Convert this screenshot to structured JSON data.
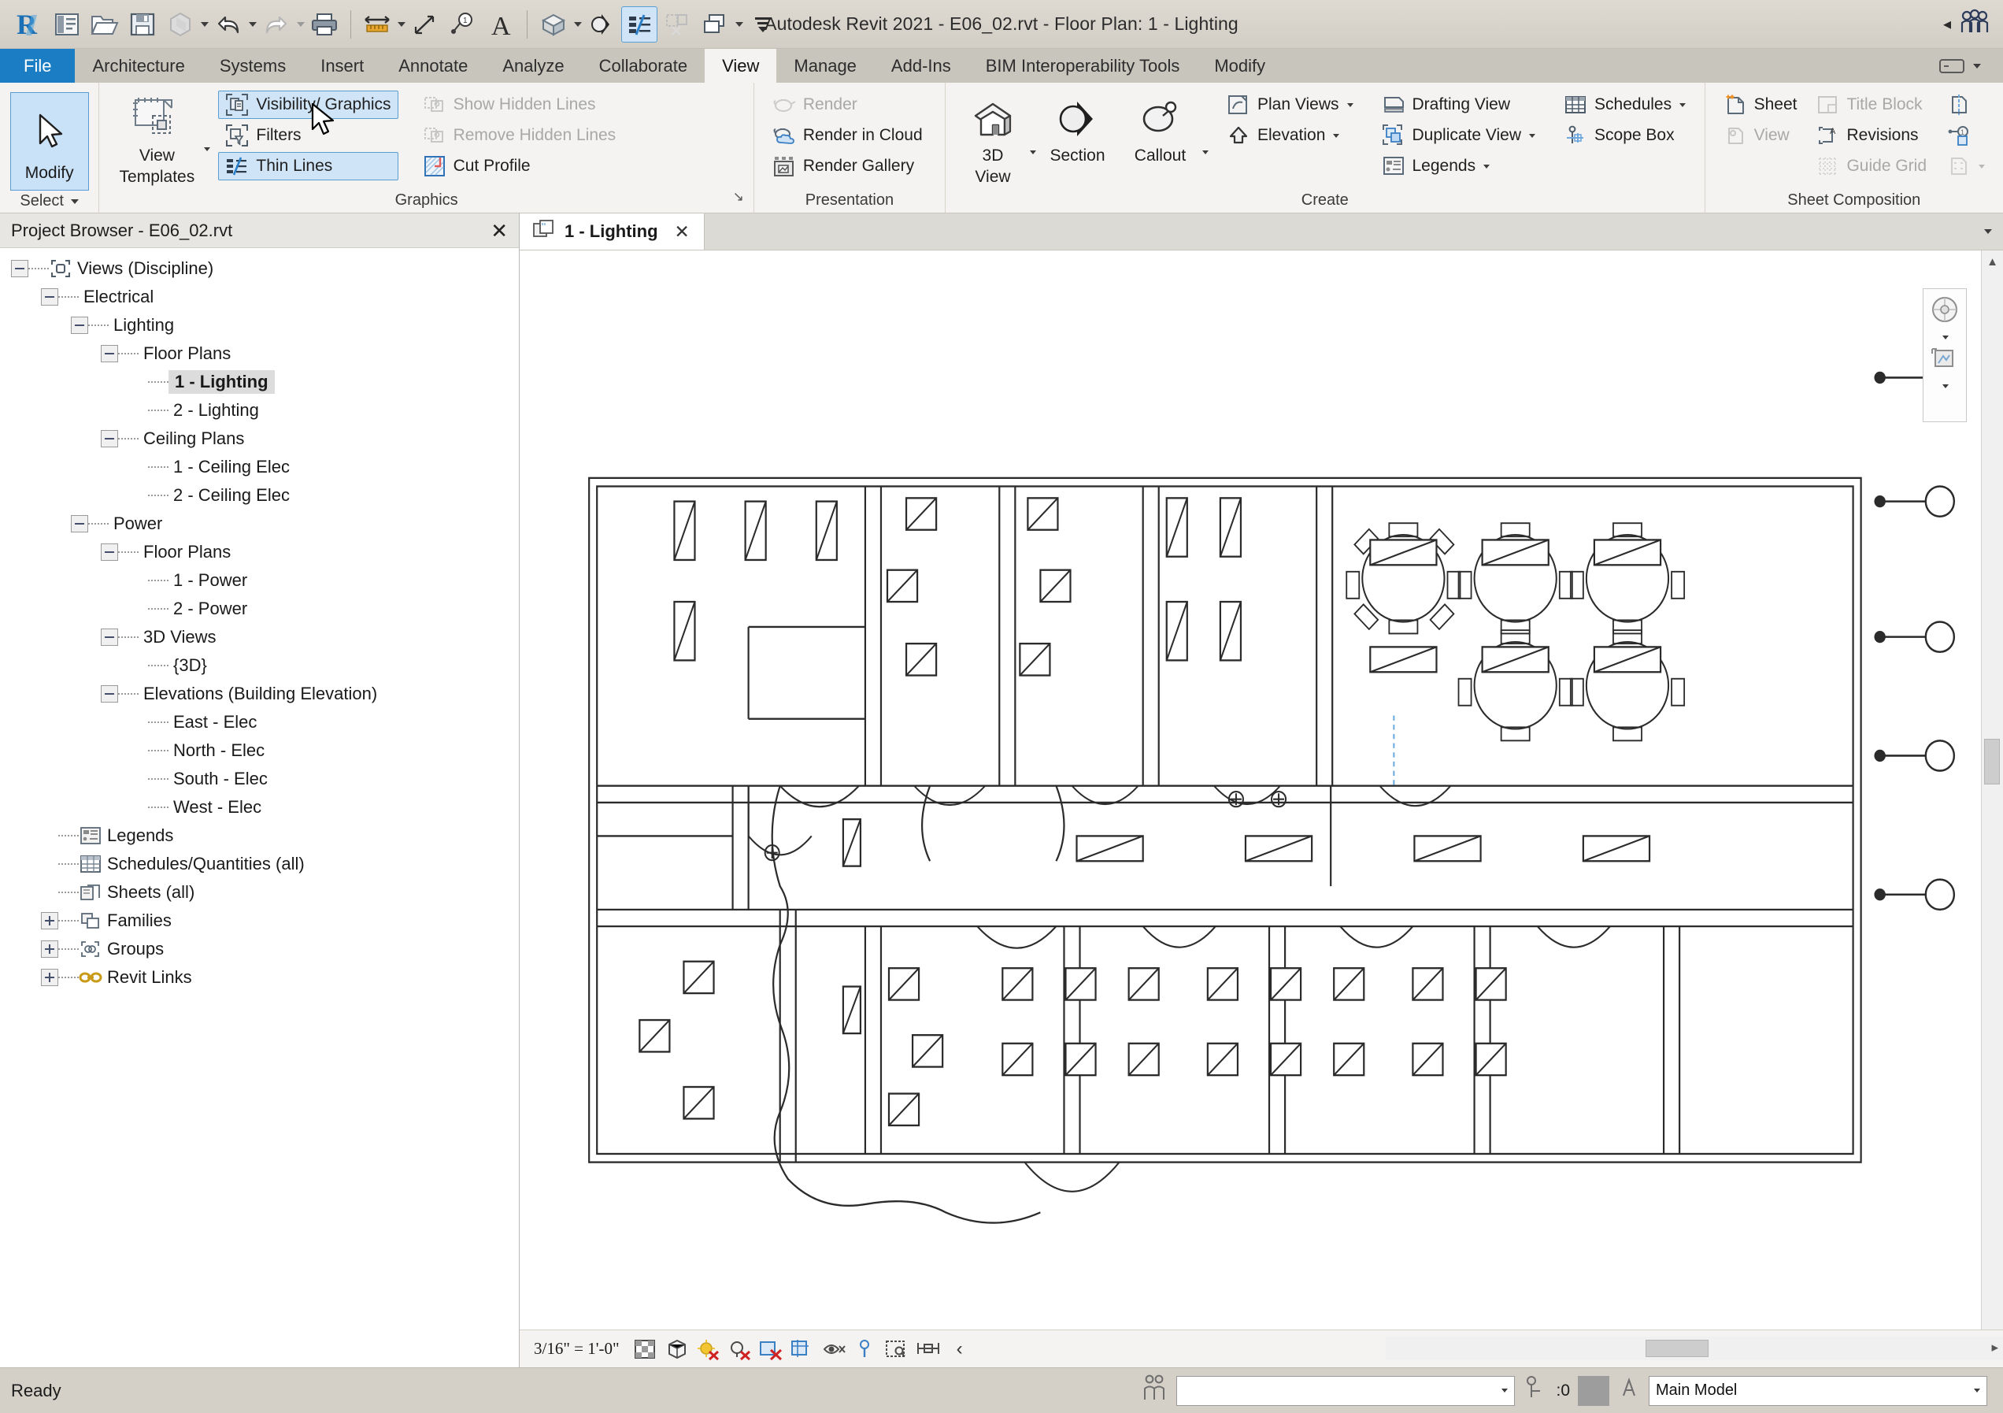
{
  "window": {
    "title": "Autodesk Revit 2021 - E06_02.rvt - Floor Plan: 1 - Lighting"
  },
  "quick_access": {
    "items": [
      {
        "name": "revit-logo-icon",
        "label": "R"
      },
      {
        "name": "project-icon",
        "label": "Project"
      },
      {
        "name": "open-icon",
        "label": "Open"
      },
      {
        "name": "save-icon",
        "label": "Save"
      },
      {
        "name": "sync-icon",
        "label": "Synchronize"
      },
      {
        "name": "undo-icon",
        "label": "Undo"
      },
      {
        "name": "redo-icon",
        "label": "Redo"
      },
      {
        "name": "print-icon",
        "label": "Print"
      },
      {
        "name": "measure-icon",
        "label": "Measure"
      },
      {
        "name": "aligned-dimension-icon",
        "label": "Aligned Dimension"
      },
      {
        "name": "tag-icon",
        "label": "Tag by Category"
      },
      {
        "name": "text-icon",
        "label": "Text"
      },
      {
        "name": "default-3d-view-icon",
        "label": "Default 3D View"
      },
      {
        "name": "section-icon",
        "label": "Section"
      },
      {
        "name": "thin-lines-icon",
        "label": "Thin Lines"
      },
      {
        "name": "close-hidden-windows-icon",
        "label": "Close Hidden Windows"
      },
      {
        "name": "switch-windows-icon",
        "label": "Switch Windows"
      },
      {
        "name": "customize-qat-icon",
        "label": "Customize Quick Access Toolbar"
      }
    ]
  },
  "tabs": {
    "items": [
      {
        "label": "File",
        "state": "file"
      },
      {
        "label": "Architecture",
        "state": "normal"
      },
      {
        "label": "Systems",
        "state": "normal"
      },
      {
        "label": "Insert",
        "state": "normal"
      },
      {
        "label": "Annotate",
        "state": "normal"
      },
      {
        "label": "Analyze",
        "state": "normal"
      },
      {
        "label": "Collaborate",
        "state": "normal"
      },
      {
        "label": "View",
        "state": "active"
      },
      {
        "label": "Manage",
        "state": "normal"
      },
      {
        "label": "Add-Ins",
        "state": "normal"
      },
      {
        "label": "BIM Interoperability Tools",
        "state": "normal"
      },
      {
        "label": "Modify",
        "state": "normal"
      }
    ]
  },
  "ribbon": {
    "select_panel": {
      "title": "Select",
      "modify_label": "Modify"
    },
    "graphics_panel": {
      "title": "Graphics",
      "view_templates_line1": "View",
      "view_templates_line2": "Templates",
      "visibility_graphics": "Visibility/ Graphics",
      "filters": "Filters",
      "thin_lines": "Thin Lines",
      "show_hidden_lines": "Show Hidden Lines",
      "remove_hidden_lines": "Remove Hidden Lines",
      "cut_profile": "Cut Profile"
    },
    "presentation_panel": {
      "title": "Presentation",
      "render": "Render",
      "render_in_cloud": "Render in Cloud",
      "render_gallery": "Render Gallery"
    },
    "create_panel": {
      "title": "Create",
      "three_d_view_line1": "3D",
      "three_d_view_line2": "View",
      "section": "Section",
      "callout": "Callout",
      "plan_views": "Plan Views",
      "elevation": "Elevation",
      "drafting_view": "Drafting View",
      "duplicate_view": "Duplicate View",
      "legends": "Legends",
      "schedules": "Schedules",
      "scope_box": "Scope Box"
    },
    "sheet_panel": {
      "title": "Sheet Composition",
      "sheet": "Sheet",
      "view": "View",
      "title_block": "Title Block",
      "revisions": "Revisions",
      "guide_grid": "Guide Grid"
    }
  },
  "browser": {
    "title": "Project Browser - E06_02.rvt",
    "close_label": "✕",
    "tree": [
      {
        "label": "Views (Discipline)",
        "depth": 0,
        "toggle": "minus",
        "icon": "views-icon",
        "selected": false
      },
      {
        "label": "Electrical",
        "depth": 1,
        "toggle": "minus",
        "icon": "",
        "selected": false
      },
      {
        "label": "Lighting",
        "depth": 2,
        "toggle": "minus",
        "icon": "",
        "selected": false
      },
      {
        "label": "Floor Plans",
        "depth": 3,
        "toggle": "minus",
        "icon": "",
        "selected": false
      },
      {
        "label": "1 - Lighting",
        "depth": 4,
        "toggle": "leaf",
        "icon": "",
        "selected": true
      },
      {
        "label": "2 - Lighting",
        "depth": 4,
        "toggle": "leaf",
        "icon": "",
        "selected": false
      },
      {
        "label": "Ceiling Plans",
        "depth": 3,
        "toggle": "minus",
        "icon": "",
        "selected": false
      },
      {
        "label": "1 - Ceiling Elec",
        "depth": 4,
        "toggle": "leaf",
        "icon": "",
        "selected": false
      },
      {
        "label": "2 - Ceiling Elec",
        "depth": 4,
        "toggle": "leaf",
        "icon": "",
        "selected": false
      },
      {
        "label": "Power",
        "depth": 2,
        "toggle": "minus",
        "icon": "",
        "selected": false
      },
      {
        "label": "Floor Plans",
        "depth": 3,
        "toggle": "minus",
        "icon": "",
        "selected": false
      },
      {
        "label": "1 - Power",
        "depth": 4,
        "toggle": "leaf",
        "icon": "",
        "selected": false
      },
      {
        "label": "2 - Power",
        "depth": 4,
        "toggle": "leaf",
        "icon": "",
        "selected": false
      },
      {
        "label": "3D Views",
        "depth": 3,
        "toggle": "minus",
        "icon": "",
        "selected": false
      },
      {
        "label": "{3D}",
        "depth": 4,
        "toggle": "leaf",
        "icon": "",
        "selected": false
      },
      {
        "label": "Elevations (Building Elevation)",
        "depth": 3,
        "toggle": "minus",
        "icon": "",
        "selected": false
      },
      {
        "label": "East - Elec",
        "depth": 4,
        "toggle": "leaf",
        "icon": "",
        "selected": false
      },
      {
        "label": "North - Elec",
        "depth": 4,
        "toggle": "leaf",
        "icon": "",
        "selected": false
      },
      {
        "label": "South - Elec",
        "depth": 4,
        "toggle": "leaf",
        "icon": "",
        "selected": false
      },
      {
        "label": "West - Elec",
        "depth": 4,
        "toggle": "leaf",
        "icon": "",
        "selected": false
      },
      {
        "label": "Legends",
        "depth": 1,
        "toggle": "leaf",
        "icon": "legends-icon",
        "selected": false
      },
      {
        "label": "Schedules/Quantities (all)",
        "depth": 1,
        "toggle": "leaf",
        "icon": "schedules-icon",
        "selected": false
      },
      {
        "label": "Sheets (all)",
        "depth": 1,
        "toggle": "leaf",
        "icon": "sheets-icon",
        "selected": false
      },
      {
        "label": "Families",
        "depth": 1,
        "toggle": "plus",
        "icon": "families-icon",
        "selected": false
      },
      {
        "label": "Groups",
        "depth": 1,
        "toggle": "plus",
        "icon": "groups-icon",
        "selected": false
      },
      {
        "label": "Revit Links",
        "depth": 1,
        "toggle": "plus",
        "icon": "links-icon",
        "selected": false
      }
    ]
  },
  "view": {
    "tab_label": "1 - Lighting",
    "tab_close": "✕"
  },
  "view_control_bar": {
    "scale": "3/16\" = 1'-0\"",
    "icons": [
      {
        "name": "detail-level-icon"
      },
      {
        "name": "visual-style-icon"
      },
      {
        "name": "sun-path-off-icon"
      },
      {
        "name": "shadows-off-icon"
      },
      {
        "name": "render-dialog-off-icon"
      },
      {
        "name": "crop-view-icon"
      },
      {
        "name": "hide-crop-region-icon"
      },
      {
        "name": "temporary-hide-isolate-icon"
      },
      {
        "name": "reveal-hidden-elements-icon"
      },
      {
        "name": "analytical-model-icon"
      },
      {
        "name": "constraints-icon"
      }
    ],
    "more_arrow": "‹"
  },
  "statusbar": {
    "ready": "Ready",
    "filter_count": ":0",
    "workset_value": "",
    "design_option_value": "Main Model"
  },
  "floorplan": {
    "description": "Electrical lighting floor plan with office rooms, conference tables, lighting fixtures and wall sconces"
  }
}
